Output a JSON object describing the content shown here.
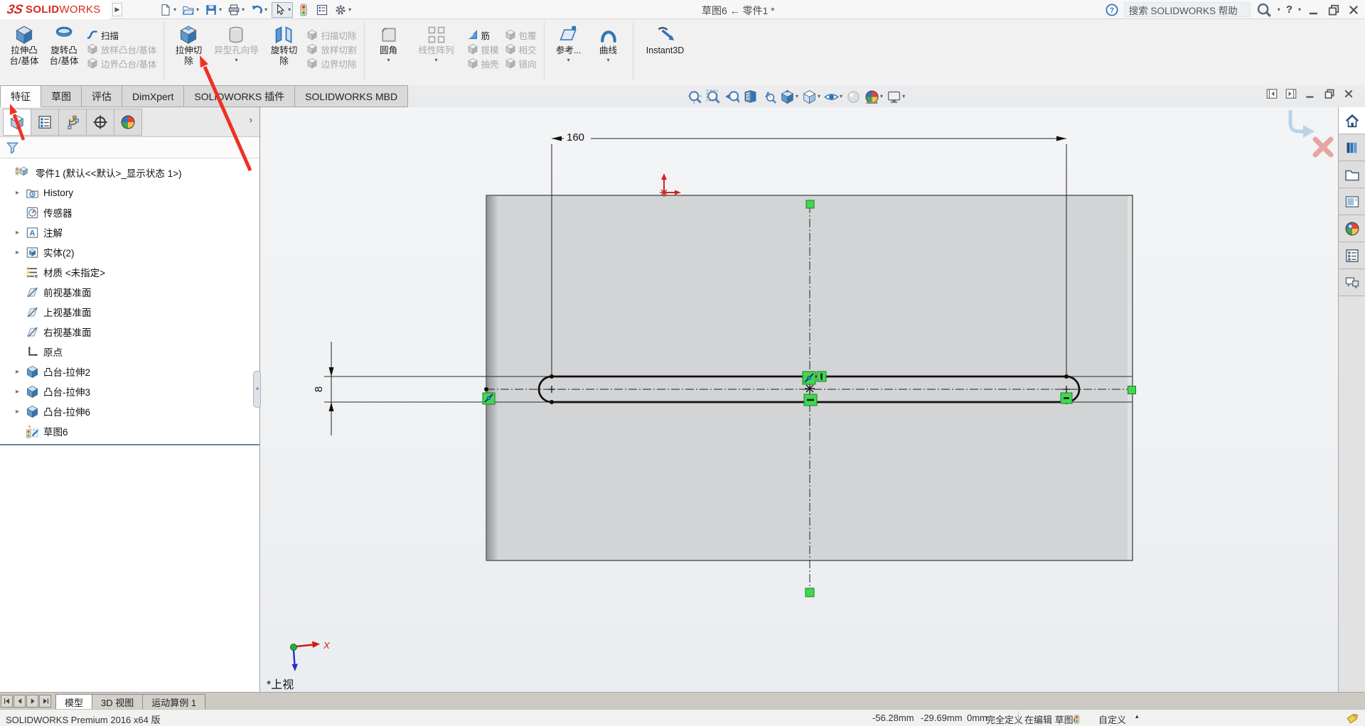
{
  "title_bar": {
    "logo_prefix": "3S",
    "logo_bold": "SOLID",
    "logo_light": "WORKS",
    "doc_title": "草图6 ← 零件1 *",
    "search_placeholder": "搜索 SOLIDWORKS 帮助",
    "help_label": "?",
    "tools": [
      {
        "icon": "new-file",
        "caret": true
      },
      {
        "icon": "open-file",
        "caret": true
      },
      {
        "icon": "save",
        "caret": true
      },
      {
        "icon": "print",
        "caret": true
      },
      {
        "icon": "undo",
        "caret": true
      },
      {
        "icon": "select-cursor",
        "caret": true,
        "boxed": true
      },
      {
        "icon": "rebuild-traffic-light",
        "caret": false
      },
      {
        "icon": "options-list",
        "caret": false
      },
      {
        "icon": "settings-gear",
        "caret": true
      }
    ]
  },
  "ribbon": {
    "groups": [
      {
        "items": [
          {
            "type": "big",
            "icon": "boss-extrude",
            "lines": [
              "拉伸凸",
              "台/基体"
            ],
            "enabled": true
          },
          {
            "type": "big",
            "icon": "revolve-boss",
            "lines": [
              "旋转凸",
              "台/基体"
            ],
            "enabled": true
          },
          {
            "type": "column",
            "items": [
              {
                "icon": "sweep",
                "label": "扫描",
                "enabled": true
              },
              {
                "icon": "loft",
                "label": "放样凸台/基体",
                "enabled": false
              },
              {
                "icon": "boundary",
                "label": "边界凸台/基体",
                "enabled": false
              }
            ]
          }
        ]
      },
      {
        "items": [
          {
            "type": "big",
            "icon": "cut-extrude",
            "lines": [
              "拉伸切",
              "除"
            ],
            "enabled": true
          },
          {
            "type": "big",
            "icon": "hole-wizard",
            "lines": [
              "异型孔向导"
            ],
            "enabled": false,
            "caret": true,
            "wide": true
          },
          {
            "type": "big",
            "icon": "cut-revolve",
            "lines": [
              "旋转切",
              "除"
            ],
            "enabled": true
          },
          {
            "type": "column",
            "items": [
              {
                "icon": "sweep-cut",
                "label": "扫描切除",
                "enabled": false
              },
              {
                "icon": "loft-cut",
                "label": "放样切割",
                "enabled": false
              },
              {
                "icon": "boundary-cut",
                "label": "边界切除",
                "enabled": false
              }
            ]
          }
        ]
      },
      {
        "items": [
          {
            "type": "big",
            "icon": "fillet",
            "lines": [
              "圆角"
            ],
            "enabled": true,
            "caret": true
          },
          {
            "type": "big",
            "icon": "linear-pattern",
            "lines": [
              "线性阵列"
            ],
            "enabled": false,
            "caret": true,
            "wide": true
          },
          {
            "type": "column",
            "items": [
              {
                "icon": "rib",
                "label": "筋",
                "enabled": true
              },
              {
                "icon": "draft",
                "label": "拔模",
                "enabled": false
              },
              {
                "icon": "shell",
                "label": "抽壳",
                "enabled": false
              }
            ]
          },
          {
            "type": "column",
            "items": [
              {
                "icon": "wrap",
                "label": "包覆",
                "enabled": false
              },
              {
                "icon": "intersect",
                "label": "相交",
                "enabled": false
              },
              {
                "icon": "mirror",
                "label": "镜向",
                "enabled": false
              }
            ]
          }
        ]
      },
      {
        "items": [
          {
            "type": "big",
            "icon": "reference-geometry",
            "lines": [
              "参考..."
            ],
            "enabled": true,
            "caret": true
          },
          {
            "type": "big",
            "icon": "curves",
            "lines": [
              "曲线"
            ],
            "enabled": true,
            "caret": true
          }
        ]
      },
      {
        "items": [
          {
            "type": "big",
            "icon": "instant3d",
            "lines": [
              "Instant3D"
            ],
            "enabled": true,
            "wide": true
          }
        ]
      }
    ]
  },
  "command_tabs": {
    "active_index": 0,
    "tabs": [
      "特征",
      "草图",
      "评估",
      "DimXpert",
      "SOLIDWORKS 插件",
      "SOLIDWORKS MBD"
    ]
  },
  "headsup": {
    "items": [
      {
        "icon": "zoom-fit"
      },
      {
        "icon": "zoom-area"
      },
      {
        "icon": "previous-view"
      },
      {
        "icon": "section-view"
      },
      {
        "icon": "annotation-view"
      },
      {
        "icon": "view-orientation",
        "caret": true
      },
      {
        "icon": "display-style",
        "caret": true
      },
      {
        "icon": "hide-show-items",
        "caret": true
      },
      {
        "icon": "edit-appearance",
        "disabled": true
      },
      {
        "icon": "apply-scene",
        "caret": true
      },
      {
        "icon": "view-settings",
        "caret": true
      }
    ]
  },
  "window_controls": {
    "doc": [
      "pane-left",
      "pane-right",
      "minimize",
      "restore",
      "close"
    ],
    "app": [
      "minimize",
      "restore",
      "close"
    ]
  },
  "feature_panel": {
    "tabs": [
      {
        "icon": "featuremanager-part"
      },
      {
        "icon": "propertymanager"
      },
      {
        "icon": "configurations"
      },
      {
        "icon": "dimxpert-manager"
      },
      {
        "icon": "display-manager"
      }
    ],
    "expand_label": "›",
    "filter_icon": "filter-funnel",
    "root": {
      "icon": "part-root",
      "label": "零件1 (默认<<默认>_显示状态 1>)"
    },
    "items": [
      {
        "icon": "history-folder",
        "label": "History",
        "expandable": true
      },
      {
        "icon": "sensors",
        "label": "传感器",
        "expandable": false
      },
      {
        "icon": "annotations-folder",
        "label": "注解",
        "expandable": true
      },
      {
        "icon": "solid-bodies-folder",
        "label": "实体(2)",
        "expandable": true
      },
      {
        "icon": "material",
        "label": "材质 <未指定>",
        "expandable": false
      },
      {
        "icon": "plane",
        "label": "前视基准面",
        "expandable": false
      },
      {
        "icon": "plane",
        "label": "上视基准面",
        "expandable": false
      },
      {
        "icon": "plane",
        "label": "右视基准面",
        "expandable": false
      },
      {
        "icon": "origin",
        "label": "原点",
        "expandable": false
      },
      {
        "icon": "boss-extrude-feature",
        "label": "凸台-拉伸2",
        "expandable": true
      },
      {
        "icon": "boss-extrude-feature",
        "label": "凸台-拉伸3",
        "expandable": true
      },
      {
        "icon": "boss-extrude-feature",
        "label": "凸台-拉伸6",
        "expandable": true
      },
      {
        "icon": "sketch-editing",
        "label": "草图6",
        "expandable": false
      }
    ]
  },
  "viewport": {
    "dimensions": {
      "slot_length": "160",
      "slot_width": "8"
    },
    "view_label": "*上视",
    "axis_x_label": "X"
  },
  "task_pane": {
    "active_index": 0,
    "items": [
      {
        "icon": "home"
      },
      {
        "icon": "design-library"
      },
      {
        "icon": "file-explorer"
      },
      {
        "icon": "view-palette"
      },
      {
        "icon": "appearances"
      },
      {
        "icon": "custom-properties"
      },
      {
        "icon": "forum"
      }
    ]
  },
  "bottom_tabs": {
    "nav_icons": [
      "nav-first",
      "nav-prev",
      "nav-next",
      "nav-last"
    ],
    "active_index": 0,
    "tabs": [
      "模型",
      "3D 视图",
      "运动算例 1"
    ]
  },
  "status_bar": {
    "left": "SOLIDWORKS Premium 2016 x64 版",
    "coord_x": "-56.28mm",
    "coord_y": "-29.69mm",
    "coord_z": "0mm",
    "definition_state": "完全定义",
    "editing_state": "在编辑 草图6",
    "unit_system": "自定义"
  },
  "colors": {
    "annotation_red": "#ef3124",
    "handle_green": "#44d554",
    "logo_red": "#d7281f",
    "icon_blue": "#4f81b4"
  }
}
